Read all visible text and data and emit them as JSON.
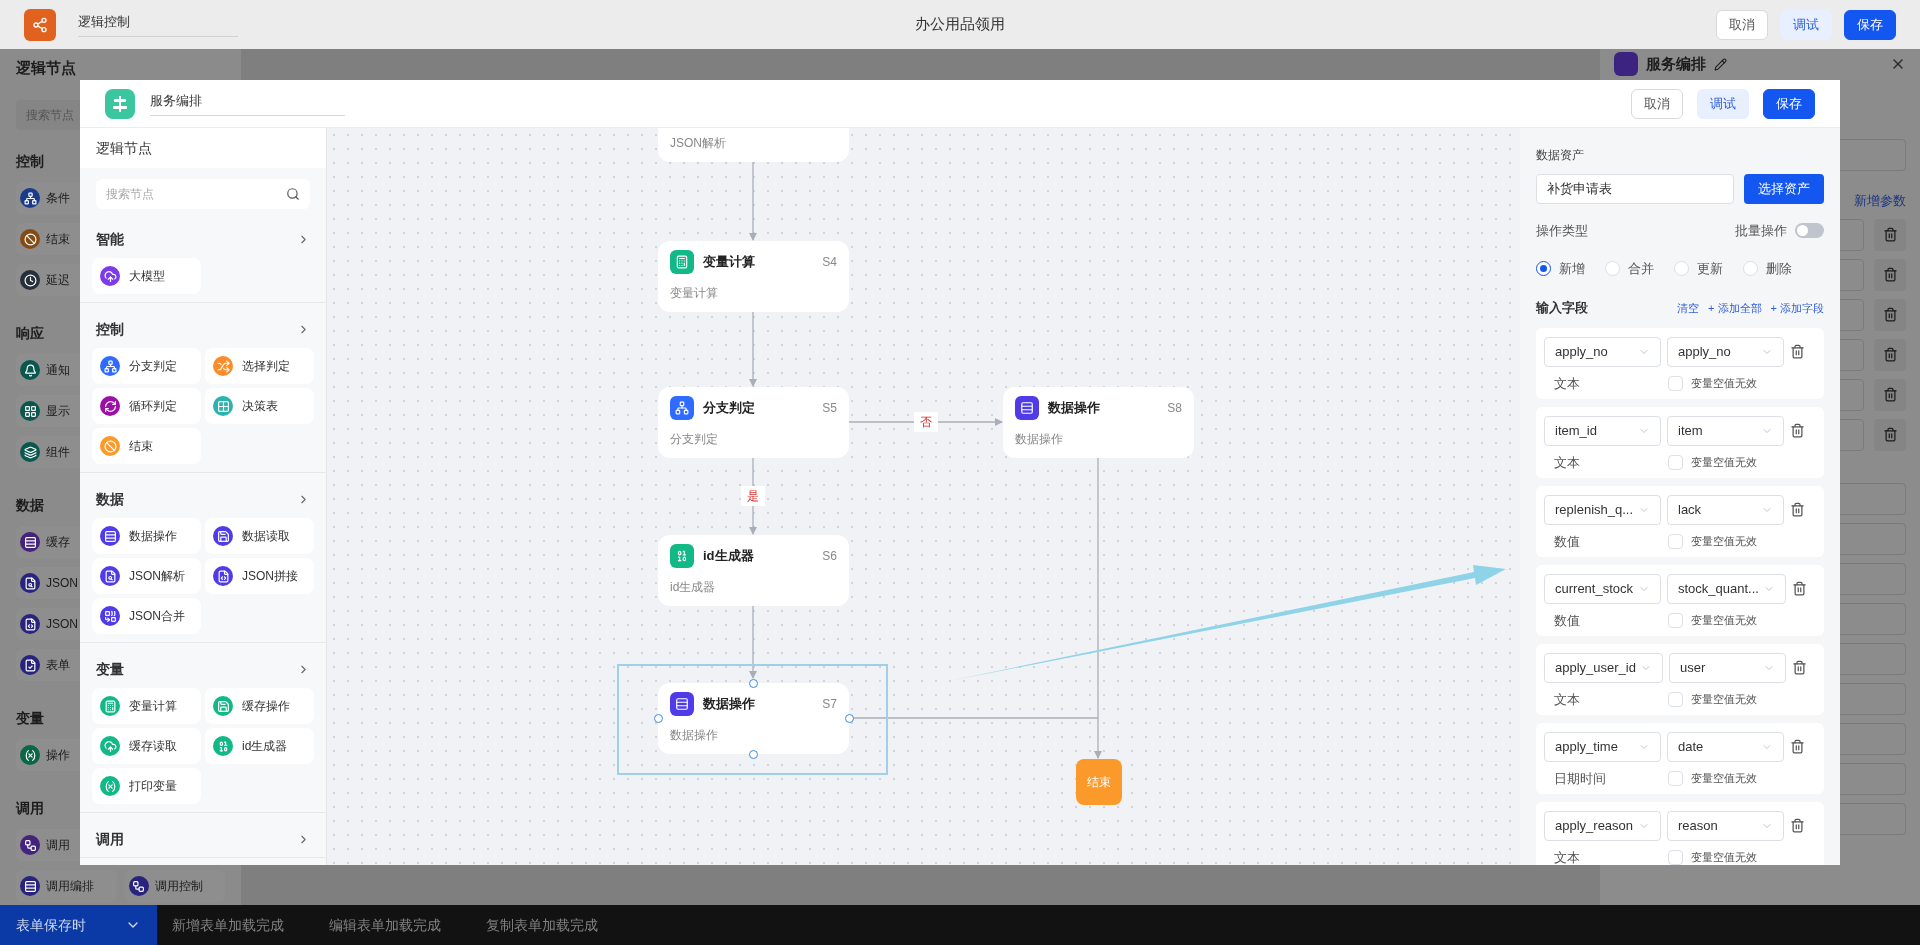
{
  "app_header": {
    "name_field": "逻辑控制",
    "page_title": "办公用品领用",
    "buttons": [
      {
        "label": "取消",
        "kind": "outline"
      },
      {
        "label": "调试",
        "kind": "soft"
      },
      {
        "label": "保存",
        "kind": "primary"
      }
    ]
  },
  "background_sidebar": {
    "title": "逻辑节点",
    "search_placeholder": "搜索节点",
    "groups": [
      {
        "label": "控制",
        "rows": [
          [
            {
              "label": "条件",
              "color": "#1a3b8c"
            }
          ],
          [
            {
              "label": "结束",
              "color": "#844c14"
            }
          ],
          [
            {
              "label": "延迟",
              "color": "#272f3a"
            }
          ]
        ]
      },
      {
        "label": "响应",
        "rows": [
          [
            {
              "label": "通知",
              "color": "#0b574e"
            }
          ],
          [
            {
              "label": "显示",
              "color": "#0b574e"
            }
          ],
          [
            {
              "label": "组件",
              "color": "#0b574e"
            }
          ]
        ]
      },
      {
        "label": "数据",
        "rows": [
          [
            {
              "label": "缓存",
              "color": "#44237d"
            }
          ],
          [
            {
              "label": "JSON",
              "color": "#29237d"
            }
          ],
          [
            {
              "label": "JSON",
              "color": "#29237d"
            }
          ],
          [
            {
              "label": "表单",
              "color": "#29237d"
            }
          ]
        ]
      },
      {
        "label": "变量",
        "rows": [
          [
            {
              "label": "操作",
              "color": "#096647"
            }
          ]
        ]
      },
      {
        "label": "调用",
        "rows": [
          [
            {
              "label": "调用",
              "color": "#44237d"
            }
          ],
          [
            {
              "label": "调用编排",
              "color": "#29237d"
            },
            {
              "label": "调用控制",
              "color": "#29237d"
            }
          ]
        ]
      }
    ]
  },
  "background_drawer": {
    "title": "服务编排",
    "link": "新增参数"
  },
  "modal": {
    "name_field": "服务编排",
    "buttons": [
      {
        "label": "取消",
        "kind": "outline"
      },
      {
        "label": "调试",
        "kind": "soft"
      },
      {
        "label": "保存",
        "kind": "primary"
      }
    ],
    "node_panel": {
      "title": "逻辑节点",
      "search_placeholder": "搜索节点",
      "groups": [
        {
          "label": "智能",
          "items": [
            {
              "label": "大模型",
              "color": "#7c3aed"
            }
          ]
        },
        {
          "label": "控制",
          "items": [
            {
              "label": "分支判定",
              "color": "#2f6bff"
            },
            {
              "label": "选择判定",
              "color": "#fb8c2b"
            },
            {
              "label": "循环判定",
              "color": "#9c10a8"
            },
            {
              "label": "决策表",
              "color": "#2bb3ad"
            },
            {
              "label": "结束",
              "color": "#fb9a2b"
            }
          ]
        },
        {
          "label": "数据",
          "items": [
            {
              "label": "数据操作",
              "color": "#4f3ce8"
            },
            {
              "label": "数据读取",
              "color": "#4f3ce8"
            },
            {
              "label": "JSON解析",
              "color": "#4f3ce8"
            },
            {
              "label": "JSON拼接",
              "color": "#4f3ce8"
            },
            {
              "label": "JSON合并",
              "color": "#4f3ce8"
            }
          ]
        },
        {
          "label": "变量",
          "items": [
            {
              "label": "变量计算",
              "color": "#12b886"
            },
            {
              "label": "缓存操作",
              "color": "#12b886"
            },
            {
              "label": "缓存读取",
              "color": "#12b886"
            },
            {
              "label": "id生成器",
              "color": "#12b886"
            },
            {
              "label": "打印变量",
              "color": "#12b886"
            }
          ]
        },
        {
          "label": "调用"
        }
      ]
    },
    "canvas": {
      "nodes": [
        {
          "kind": "task",
          "subtitle": "JSON解析",
          "selected": false
        },
        {
          "kind": "task",
          "title": "变量计算",
          "step": "S4",
          "subtitle": "变量计算",
          "color": "#12b886",
          "selected": false
        },
        {
          "kind": "task",
          "title": "分支判定",
          "step": "S5",
          "subtitle": "分支判定",
          "color": "#2f6bff",
          "selected": false
        },
        {
          "kind": "task",
          "title": "数据操作",
          "step": "S8",
          "subtitle": "数据操作",
          "color": "#4f3ce8",
          "selected": false
        },
        {
          "kind": "task",
          "title": "id生成器",
          "step": "S6",
          "subtitle": "id生成器",
          "color": "#12b886",
          "selected": false
        },
        {
          "kind": "task",
          "title": "数据操作",
          "step": "S7",
          "subtitle": "数据操作",
          "color": "#4f3ce8",
          "selected": true
        },
        {
          "kind": "end",
          "title": "结束",
          "color": "#fb9a2b",
          "selected": false
        }
      ],
      "branch_labels": [
        "否",
        "是"
      ]
    },
    "config": {
      "asset_label": "数据资产",
      "asset_value": "补货申请表",
      "asset_button": "选择资产",
      "op_label": "操作类型",
      "batch": {
        "label": "批量操作",
        "on": false
      },
      "operations": [
        {
          "label": "新增",
          "selected": true
        },
        {
          "label": "合并",
          "selected": false
        },
        {
          "label": "更新",
          "selected": false
        },
        {
          "label": "删除",
          "selected": false
        }
      ],
      "fields_label": "输入字段",
      "links": [
        "清空",
        "+ 添加全部",
        "+ 添加字段"
      ],
      "fields": [
        {
          "source": "apply_no",
          "target": "apply_no",
          "type": "文本",
          "checkbox_label": "变量空值无效",
          "checked": false
        },
        {
          "source": "item_id",
          "target": "item",
          "type": "文本",
          "checkbox_label": "变量空值无效",
          "checked": false
        },
        {
          "source": "replenish_q...",
          "target": "lack",
          "type": "数值",
          "checkbox_label": "变量空值无效",
          "checked": false
        },
        {
          "source": "current_stock",
          "target": "stock_quant...",
          "type": "数值",
          "checkbox_label": "变量空值无效",
          "checked": false
        },
        {
          "source": "apply_user_id",
          "target": "user",
          "type": "文本",
          "checkbox_label": "变量空值无效",
          "checked": false
        },
        {
          "source": "apply_time",
          "target": "date",
          "type": "日期时间",
          "checkbox_label": "变量空值无效",
          "checked": false
        },
        {
          "source": "apply_reason",
          "target": "reason",
          "type": "文本",
          "checkbox_label": "变量空值无效",
          "checked": false
        }
      ]
    }
  },
  "bottom_bar": {
    "tabs": [
      {
        "label": "表单保存时",
        "selected": true
      },
      {
        "label": "新增表单加载完成",
        "selected": false
      },
      {
        "label": "编辑表单加载完成",
        "selected": false
      },
      {
        "label": "复制表单加载完成",
        "selected": false
      }
    ]
  }
}
